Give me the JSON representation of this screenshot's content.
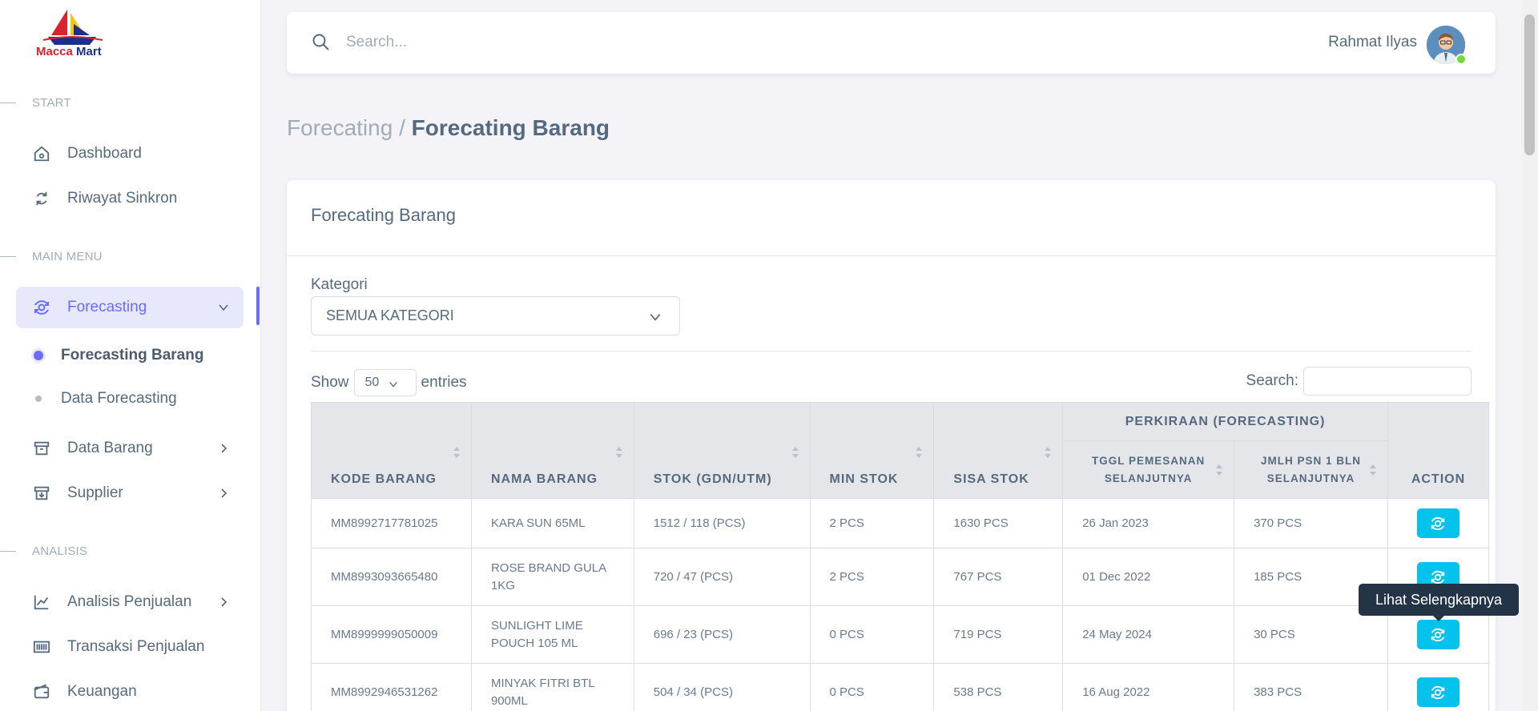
{
  "logo": {
    "text_a": "Macca",
    "text_b": " Mart"
  },
  "sidebar": {
    "section_start": "START",
    "dashboard": "Dashboard",
    "riwayat": "Riwayat Sinkron",
    "section_main": "MAIN MENU",
    "forecasting": "Forecasting",
    "forecasting_barang": "Forecasting Barang",
    "data_forecasting": "Data Forecasting",
    "data_barang": "Data Barang",
    "supplier": "Supplier",
    "section_analisis": "ANALISIS",
    "analisis_penjualan": "Analisis Penjualan",
    "transaksi": "Transaksi Penjualan",
    "keuangan": "Keuangan"
  },
  "topbar": {
    "search_placeholder": "Search...",
    "user_name": "Rahmat Ilyas"
  },
  "breadcrumb": {
    "parent": "Forecating /",
    "current": "Forecating Barang"
  },
  "card": {
    "title": "Forecating Barang",
    "kategori_label": "Kategori",
    "kategori_value": "SEMUA KATEGORI",
    "show_label": "Show",
    "show_value": "50",
    "entries_label": "entries",
    "search_label": "Search:"
  },
  "table": {
    "headers": {
      "kode": "KODE BARANG",
      "nama": "NAMA BARANG",
      "stok": "STOK (GDN/UTM)",
      "min": "MIN STOK",
      "sisa": "SISA STOK",
      "group": "PERKIRAAN (FORECASTING)",
      "tggl_1": "TGGL PEMESANAN",
      "tggl_2": "SELANJUTNYA",
      "jmlh_1": "JMLH PSN 1 BLN",
      "jmlh_2": "SELANJUTNYA",
      "action": "ACTION"
    },
    "rows": [
      {
        "kode": "MM8992717781025",
        "nama": "KARA SUN 65ML",
        "stok": "1512 / 118 (PCS)",
        "min": "2 PCS",
        "sisa": "1630 PCS",
        "tggl": "26 Jan 2023",
        "jmlh": "370 PCS"
      },
      {
        "kode": "MM8993093665480",
        "nama": "ROSE BRAND GULA 1KG",
        "stok": "720 / 47 (PCS)",
        "min": "2 PCS",
        "sisa": "767 PCS",
        "tggl": "01 Dec 2022",
        "jmlh": "185 PCS"
      },
      {
        "kode": "MM8999999050009",
        "nama": "SUNLIGHT LIME POUCH 105 ML",
        "stok": "696 / 23 (PCS)",
        "min": "0 PCS",
        "sisa": "719 PCS",
        "tggl": "24 May 2024",
        "jmlh": "30 PCS"
      },
      {
        "kode": "MM8992946531262",
        "nama": "MINYAK FITRI BTL 900ML",
        "stok": "504 / 34 (PCS)",
        "min": "0 PCS",
        "sisa": "538 PCS",
        "tggl": "16 Aug 2022",
        "jmlh": "383 PCS"
      }
    ]
  },
  "tooltip": "Lihat Selengkapnya",
  "colors": {
    "primary": "#696cff",
    "info": "#03c3ec",
    "text": "#566a7f",
    "muted": "#a1acb8"
  }
}
